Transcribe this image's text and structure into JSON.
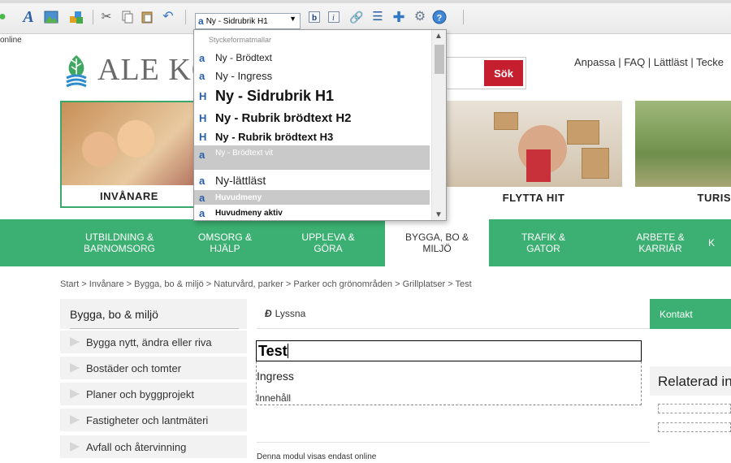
{
  "toolbar": {
    "style_value": "Ny - Sidrubrik H1",
    "icons": [
      "circle-icon",
      "font-color-icon",
      "image-icon",
      "component-icon",
      "cut-icon",
      "copy-icon",
      "paste-icon",
      "undo-icon",
      "bold-icon",
      "italic-icon",
      "link-icon",
      "list-icon",
      "insert-icon",
      "settings-icon",
      "help-icon"
    ]
  },
  "online_label": "online",
  "header": {
    "logo_text": "ALE KO",
    "search_button": "Sök",
    "top_links": "Anpassa | FAQ | Lättläst | Tecke"
  },
  "tiles": [
    {
      "caption": "INVÅNARE"
    },
    {
      "caption": "FLYTTA HIT"
    },
    {
      "caption": "TURIS"
    }
  ],
  "nav": [
    {
      "line1": "UTBILDNING &",
      "line2": "BARNOMSORG"
    },
    {
      "line1": "OMSORG &",
      "line2": "HJÄLP"
    },
    {
      "line1": "UPPLEVA &",
      "line2": "GÖRA"
    },
    {
      "line1": "BYGGA, BO &",
      "line2": "MILJÖ"
    },
    {
      "line1": "TRAFIK &",
      "line2": "GATOR"
    },
    {
      "line1": "ARBETE &",
      "line2": "KARRIÄR"
    },
    {
      "line1": "K",
      "line2": ""
    }
  ],
  "breadcrumb": "Start > Invånare > Bygga, bo & miljö > Naturvård, parker > Parker och grönområden > Grillplatser > Test",
  "subnav": {
    "title": "Bygga, bo & miljö",
    "items": [
      "Bygga nytt, ändra eller riva",
      "Bostäder och tomter",
      "Planer och byggprojekt",
      "Fastigheter och lantmäteri",
      "Avfall och återvinning"
    ]
  },
  "content": {
    "listen": "Lyssna",
    "title_value": "Test",
    "ingress": "Ingress",
    "innehall": "Innehåll",
    "module_note": "Denna modul visas endast online"
  },
  "right": {
    "contact": "Kontakt",
    "related": "Relaterad in"
  },
  "dropdown": {
    "header": "Styckeformatmallar",
    "items": [
      {
        "label": "Ny - Brödtext"
      },
      {
        "label": "Ny - Ingress"
      },
      {
        "label": "Ny - Sidrubrik H1"
      },
      {
        "label": "Ny - Rubrik brödtext H2"
      },
      {
        "label": "Ny - Rubrik brödtext H3"
      },
      {
        "label": "Ny - Brödtext vit"
      },
      {
        "label": "Ny-lättläst"
      },
      {
        "label": "Huvudmeny"
      },
      {
        "label": "Huvudmeny aktiv"
      }
    ]
  },
  "colors": {
    "brand_green": "#3cb072",
    "search_red": "#c41e2f",
    "selected_gray": "#c9c9c9"
  }
}
